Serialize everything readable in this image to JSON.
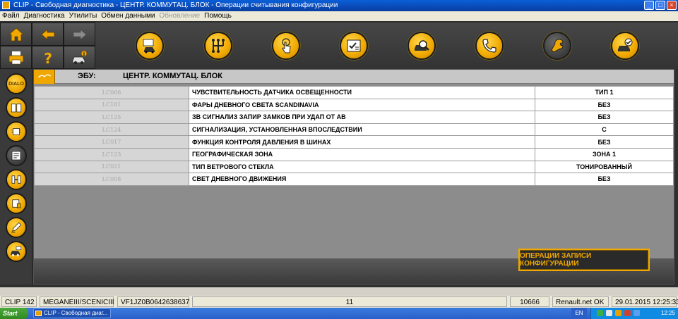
{
  "window": {
    "title": "CLIP - Свободная диагностика - ЦЕНТР. КОММУТАЦ. БЛОК - Операции считывания конфигурации",
    "buttons": [
      "_",
      "□",
      "×"
    ]
  },
  "menu": [
    {
      "label": "Файл",
      "enabled": true
    },
    {
      "label": "Диагностика",
      "enabled": true
    },
    {
      "label": "Утилиты",
      "enabled": true
    },
    {
      "label": "Обмен данными",
      "enabled": true
    },
    {
      "label": "Обновление",
      "enabled": false
    },
    {
      "label": "Помощь",
      "enabled": true
    }
  ],
  "nav_icons": [
    "home-icon",
    "back-arrow-icon",
    "forward-arrow-icon",
    "printer-icon",
    "help-icon",
    "vehicle-info-icon"
  ],
  "toolbar_icons": [
    "vehicle-identification-icon",
    "gearbox-icon",
    "touch-icon",
    "checklist-icon",
    "fault-search-icon",
    "phone-support-icon",
    "wrench-icon",
    "vehicle-ok-icon"
  ],
  "sidebar": {
    "items": [
      {
        "icon": "dialogys-icon",
        "label": "DIALO"
      },
      {
        "icon": "manual-book-icon",
        "label": ""
      },
      {
        "icon": "ecu-list-icon",
        "label": ""
      },
      {
        "icon": "ecu-config-icon",
        "label": ""
      },
      {
        "icon": "connector-icon",
        "label": ""
      },
      {
        "icon": "ecu-module-icon",
        "label": ""
      },
      {
        "icon": "pen-edit-icon",
        "label": ""
      },
      {
        "icon": "vehicle-test-icon",
        "label": ""
      }
    ]
  },
  "ecu": {
    "label": "ЭБУ:",
    "name": "ЦЕНТР. КОММУТАЦ. БЛОК"
  },
  "config_rows": [
    {
      "code": "LC066",
      "param": "ЧУВСТВИТЕЛЬНОСТЬ ДАТЧИКА ОСВЕЩЕННОСТИ",
      "value": "ТИП 1"
    },
    {
      "code": "LC181",
      "param": "ФАРЫ ДНЕВНОГО СВЕТА SCANDINAVIA",
      "value": "БЕЗ"
    },
    {
      "code": "LC125",
      "param": "ЗВ СИГНАЛИЗ ЗАПИР ЗАМКОВ ПРИ УДАП ОТ АВ",
      "value": "БЕЗ"
    },
    {
      "code": "LC124",
      "param": "СИГНАЛИЗАЦИЯ, УСТАНОВЛЕННАЯ ВПОСЛЕДСТВИИ",
      "value": "С"
    },
    {
      "code": "LC017",
      "param": "ФУНКЦИЯ КОНТРОЛЯ ДАВЛЕНИЯ В ШИНАХ",
      "value": "БЕЗ"
    },
    {
      "code": "LC123",
      "param": "ГЕОГРАФИЧЕСКАЯ ЗОНА",
      "value": "ЗОНА 1"
    },
    {
      "code": "LC021",
      "param": "ТИП ВЕТРОВОГО СТЕКЛА",
      "value": "ТОНИРОВАННЫЙ"
    },
    {
      "code": "LC008",
      "param": "СВЕТ ДНЕВНОГО ДВИЖЕНИЯ",
      "value": "БЕЗ"
    }
  ],
  "write_button": "ОПЕРАЦИИ ЗАПИСИ КОНФИГУРАЦИИ",
  "status": {
    "clip_version": "CLIP 142",
    "vehicle": "MEGANEIII/SCENICIII",
    "vin": "VF1JZ0B0642638637",
    "count": "11",
    "code": "10666",
    "network": "Renault.net OK",
    "datetime": "29.01.2015 12:25:33"
  },
  "taskbar": {
    "start": "Start",
    "task": "CLIP - Свободная диаг...",
    "lang": "EN",
    "clock": "12:25"
  },
  "colors": {
    "accent": "#f0a800",
    "dark_bg": "#2f2f2f",
    "panel_bg": "#8c8c8c",
    "xp_blue": "#0a4ab8"
  }
}
